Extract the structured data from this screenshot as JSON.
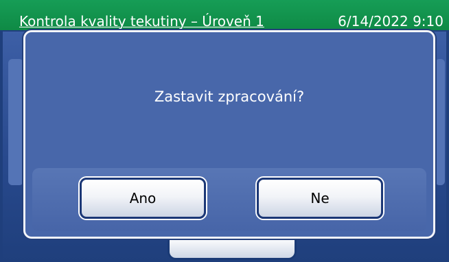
{
  "header": {
    "title": "Kontrola kvality tekutiny – Úroveň 1",
    "datetime": "6/14/2022 9:10"
  },
  "dialog": {
    "message": "Zastavit zpracování?",
    "yes_label": "Ano",
    "no_label": "Ne"
  },
  "colors": {
    "header_green": "#169d56",
    "dialog_blue": "#4867aa",
    "background_navy": "#1f3f7c"
  }
}
